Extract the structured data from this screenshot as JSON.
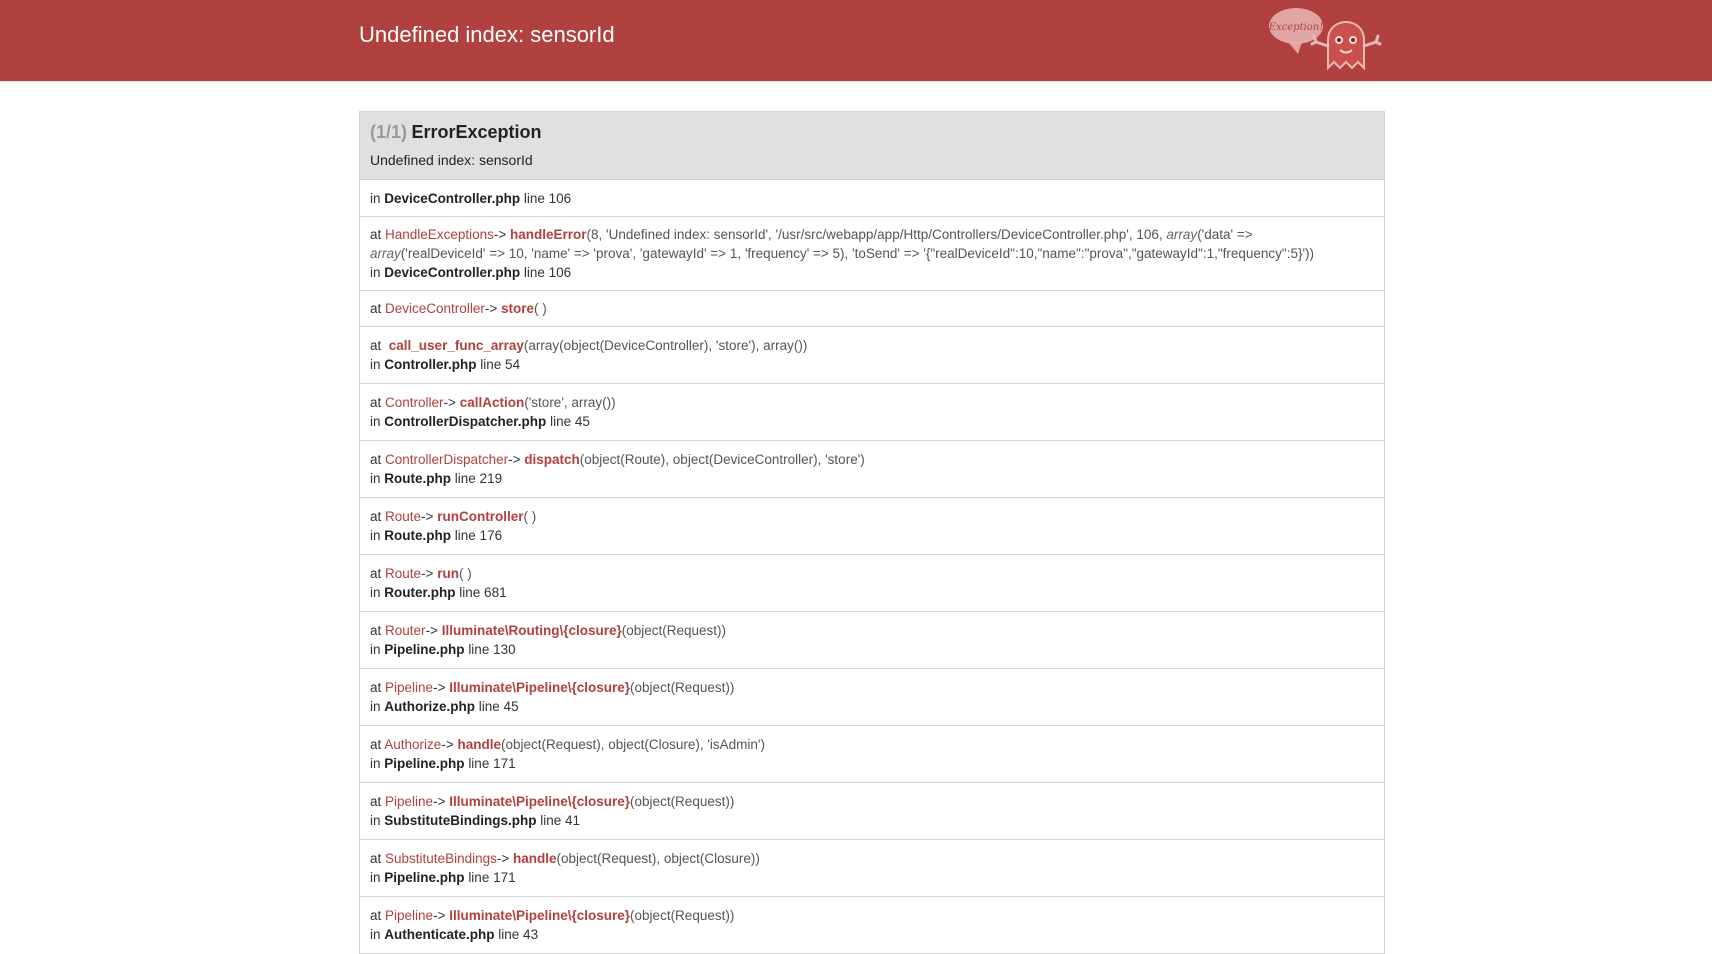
{
  "header": {
    "title": "Undefined index: sensorId",
    "logo_text": "Exception!"
  },
  "exception": {
    "count": "(1/1)",
    "class": "ErrorException",
    "message": "Undefined index: sensorId",
    "location": {
      "prefix": "in",
      "file": "DeviceController.php",
      "line": "line 106"
    }
  },
  "frames": [
    {
      "at": "at",
      "class": "HandleExceptions",
      "arrow": "->",
      "function": "handleError",
      "args_l1": "(8, 'Undefined index: sensorId', '/usr/src/webapp/app/Http/Controllers/DeviceController.php', 106, ",
      "args_l1_italic": "array",
      "args_l1_end": "('data' =>",
      "args_l2_italic": "array",
      "args_l2": "('realDeviceId' => 10, 'name' => 'prova', 'gatewayId' => 1, 'frequency' => 5), 'toSend' => '{\"realDeviceId\":10,\"name\":\"prova\",\"gatewayId\":1,\"frequency\":5}'))",
      "in": "in",
      "file": "DeviceController.php",
      "line": "line 106"
    },
    {
      "at": "at",
      "class": "DeviceController",
      "arrow": "->",
      "function": "store",
      "args": "( )"
    },
    {
      "at": "at",
      "function": "call_user_func_array",
      "args": "(array(object(DeviceController), 'store'), array())",
      "in": "in",
      "file": "Controller.php",
      "line": "line 54"
    },
    {
      "at": "at",
      "class": "Controller",
      "arrow": "->",
      "function": "callAction",
      "args": "('store', array())",
      "in": "in",
      "file": "ControllerDispatcher.php",
      "line": "line 45"
    },
    {
      "at": "at",
      "class": "ControllerDispatcher",
      "arrow": "->",
      "function": "dispatch",
      "args": "(object(Route), object(DeviceController), 'store')",
      "in": "in",
      "file": "Route.php",
      "line": "line 219"
    },
    {
      "at": "at",
      "class": "Route",
      "arrow": "->",
      "function": "runController",
      "args": "( )",
      "in": "in",
      "file": "Route.php",
      "line": "line 176"
    },
    {
      "at": "at",
      "class": "Route",
      "arrow": "->",
      "function": "run",
      "args": "( )",
      "in": "in",
      "file": "Router.php",
      "line": "line 681"
    },
    {
      "at": "at",
      "class": "Router",
      "arrow": "->",
      "function": "Illuminate\\Routing\\{closure}",
      "args": "(object(Request))",
      "in": "in",
      "file": "Pipeline.php",
      "line": "line 130"
    },
    {
      "at": "at",
      "class": "Pipeline",
      "arrow": "->",
      "function": "Illuminate\\Pipeline\\{closure}",
      "args": "(object(Request))",
      "in": "in",
      "file": "Authorize.php",
      "line": "line 45"
    },
    {
      "at": "at",
      "class": "Authorize",
      "arrow": "->",
      "function": "handle",
      "args": "(object(Request), object(Closure), 'isAdmin')",
      "in": "in",
      "file": "Pipeline.php",
      "line": "line 171"
    },
    {
      "at": "at",
      "class": "Pipeline",
      "arrow": "->",
      "function": "Illuminate\\Pipeline\\{closure}",
      "args": "(object(Request))",
      "in": "in",
      "file": "SubstituteBindings.php",
      "line": "line 41"
    },
    {
      "at": "at",
      "class": "SubstituteBindings",
      "arrow": "->",
      "function": "handle",
      "args": "(object(Request), object(Closure))",
      "in": "in",
      "file": "Pipeline.php",
      "line": "line 171"
    },
    {
      "at": "at",
      "class": "Pipeline",
      "arrow": "->",
      "function": "Illuminate\\Pipeline\\{closure}",
      "args": "(object(Request))",
      "in": "in",
      "file": "Authenticate.php",
      "line": "line 43"
    }
  ],
  "colors": {
    "header_bg": "#b0413e",
    "accent": "#b0413e",
    "exception_head_bg": "#e0e0e0"
  },
  "icons": {
    "logo": "ghost-exception-icon"
  }
}
